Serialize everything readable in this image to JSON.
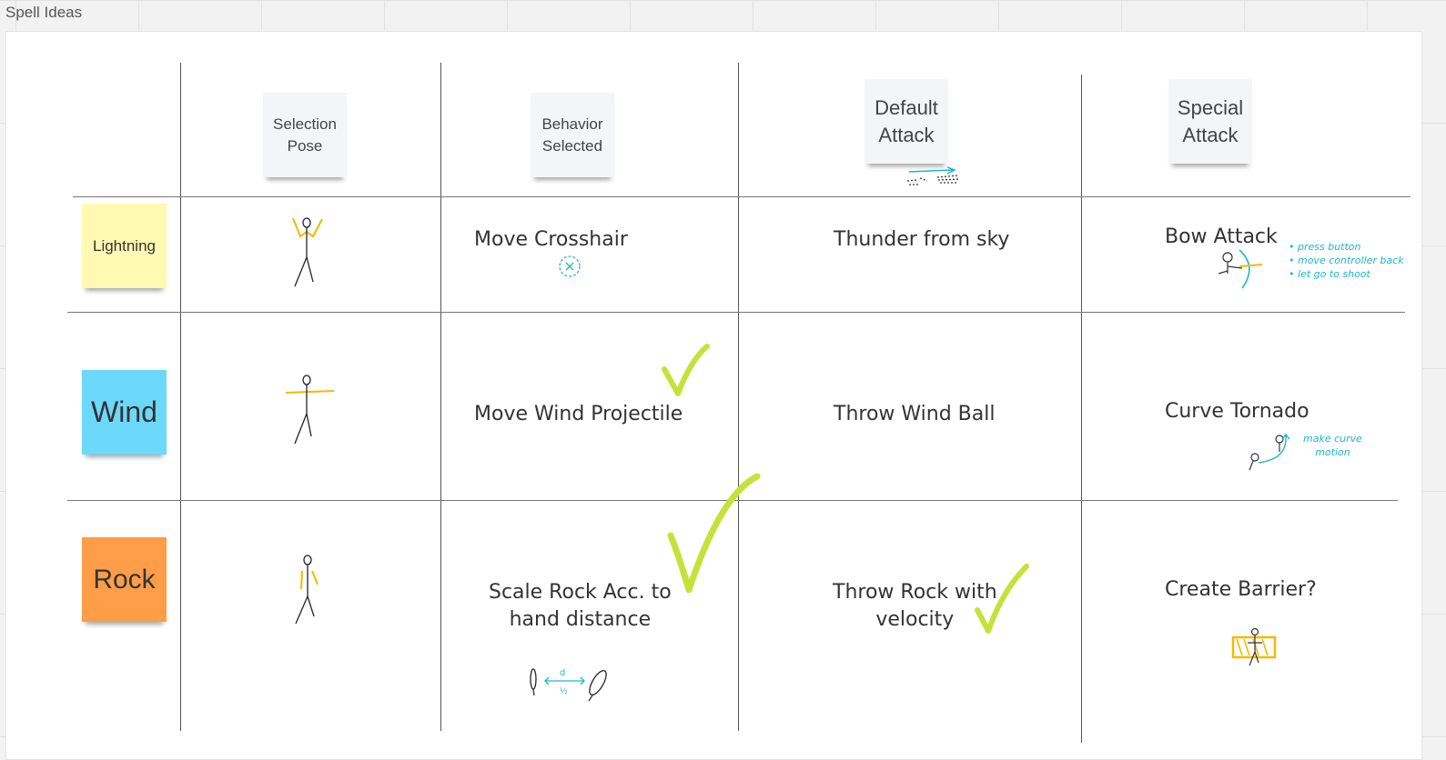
{
  "board": {
    "frame_title": "Spell Ideas"
  },
  "headers": {
    "selection_pose": [
      "Selection",
      "Pose"
    ],
    "behavior_selected": [
      "Behavior",
      "Selected"
    ],
    "default_attack": [
      "Default",
      "Attack"
    ],
    "special_attack": [
      "Special",
      "Attack"
    ]
  },
  "rows": [
    {
      "element": "Lightning",
      "element_color": "#fff9b1",
      "behavior": "Move Crosshair",
      "default_attack": "Thunder from sky",
      "special_attack": "Bow Attack",
      "special_note": [
        "• press button",
        "• move controller back",
        "• let go to shoot"
      ]
    },
    {
      "element": "Wind",
      "element_color": "#6cd8fa",
      "behavior": "Move Wind Projectile",
      "default_attack": "Throw Wind Ball",
      "special_attack": "Curve Tornado",
      "special_note": [
        "make curve",
        "motion"
      ]
    },
    {
      "element": "Rock",
      "element_color": "#ff9d48",
      "behavior": [
        "Scale Rock Acc. to",
        "hand distance"
      ],
      "default_attack": [
        "Throw Rock with",
        "velocity"
      ],
      "special_attack": "Create Barrier?"
    }
  ],
  "colors": {
    "check": "#c5e23a",
    "annotation": "#1cb8c8",
    "pose_arm": "#f5b800"
  },
  "icons": [
    "stick-figure-icon",
    "checkmark-icon",
    "crosshair-icon",
    "bow-icon",
    "arrow-icon"
  ]
}
